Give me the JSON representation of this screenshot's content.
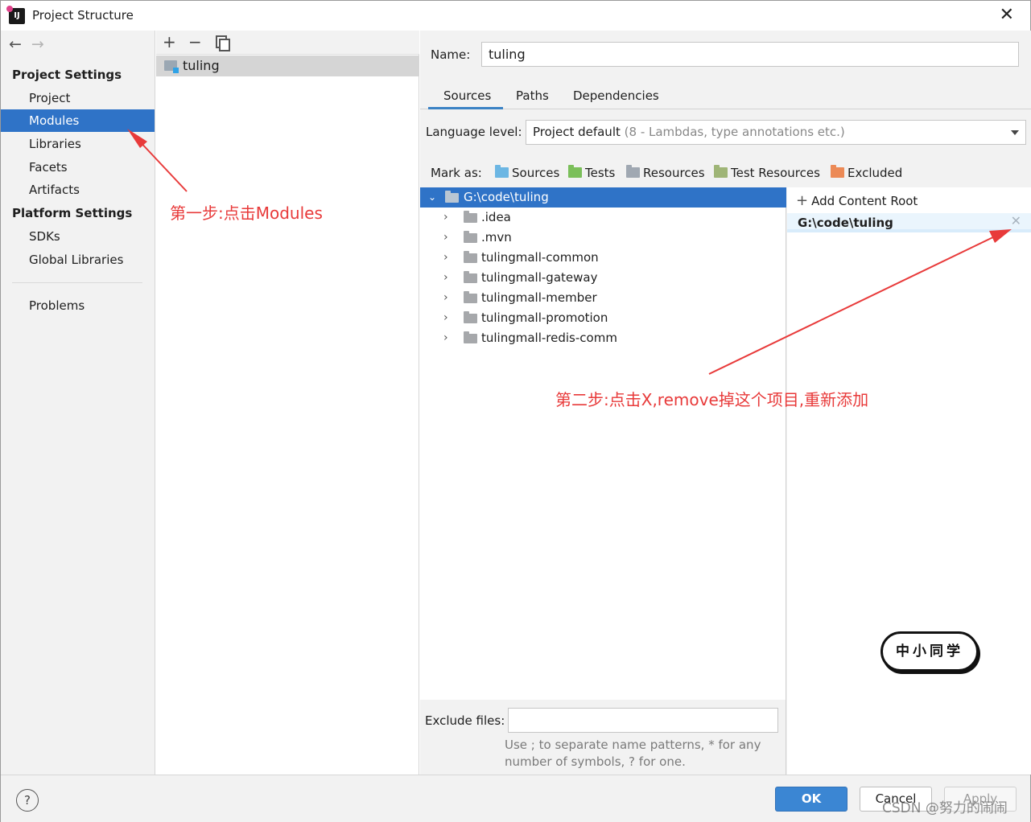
{
  "window": {
    "title": "Project Structure",
    "close_icon": "close-icon"
  },
  "sidebar": {
    "project_settings_heading": "Project Settings",
    "project_items": [
      "Project",
      "Modules",
      "Libraries",
      "Facets",
      "Artifacts"
    ],
    "selected_item": "Modules",
    "platform_settings_heading": "Platform Settings",
    "platform_items": [
      "SDKs",
      "Global Libraries"
    ],
    "problems": "Problems"
  },
  "modules": {
    "items": [
      "tuling"
    ]
  },
  "details": {
    "name_label": "Name:",
    "name_value": "tuling",
    "tabs": [
      "Sources",
      "Paths",
      "Dependencies"
    ],
    "active_tab": "Sources",
    "language_level_label": "Language level:",
    "language_level_value": "Project default",
    "language_level_hint": "(8 - Lambdas, type annotations etc.)",
    "mark_as_label": "Mark as:",
    "mark_as": [
      {
        "label": "Sources",
        "color": "#6cb6e3"
      },
      {
        "label": "Tests",
        "color": "#7bbf5a"
      },
      {
        "label": "Resources",
        "color": "#a0a8b2"
      },
      {
        "label": "Test Resources",
        "color": "#9fb577"
      },
      {
        "label": "Excluded",
        "color": "#ec8a56"
      }
    ],
    "tree": {
      "root": "G:\\code\\tuling",
      "children": [
        ".idea",
        ".mvn",
        "tulingmall-common",
        "tulingmall-gateway",
        "tulingmall-member",
        "tulingmall-promotion",
        "tulingmall-redis-comm"
      ]
    },
    "add_content_root": "Add Content Root",
    "content_root_path": "G:\\code\\tuling",
    "exclude_files_label": "Exclude files:",
    "exclude_files_value": "",
    "exclude_hint_line1": "Use ; to separate name patterns, * for any",
    "exclude_hint_line2": "number of symbols, ? for one."
  },
  "footer": {
    "help": "?",
    "ok": "OK",
    "cancel": "Cancel",
    "apply": "Apply"
  },
  "annotations": {
    "step1": "第一步:点击Modules",
    "step2": "第二步:点击X,remove掉这个项目,重新添加",
    "color": "#e83a3a"
  },
  "stamp_text": "中小同学",
  "watermark": "CSDN @努力的闹闹"
}
